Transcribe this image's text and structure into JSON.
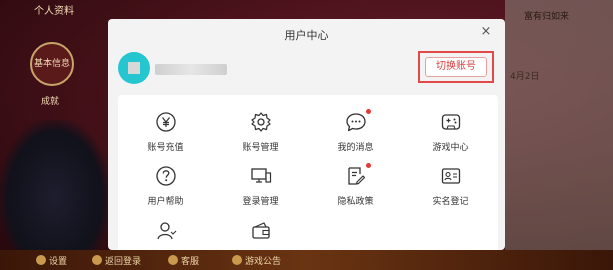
{
  "background": {
    "title": "个人资料",
    "badges": [
      "基本信息",
      "成就"
    ],
    "right_labels": [
      "富有归如来",
      "4月2日"
    ],
    "bottom_bar": [
      "设置",
      "返回登录",
      "客服",
      "游戏公告"
    ]
  },
  "modal": {
    "title": "用户中心",
    "close_label": "×",
    "switch_account_label": "切换账号",
    "grid": [
      {
        "label": "账号充值",
        "icon": "yen-icon",
        "dot": false
      },
      {
        "label": "账号管理",
        "icon": "gear-icon",
        "dot": false
      },
      {
        "label": "我的消息",
        "icon": "message-icon",
        "dot": true
      },
      {
        "label": "游戏中心",
        "icon": "gamepad-icon",
        "dot": false
      },
      {
        "label": "用户帮助",
        "icon": "help-icon",
        "dot": false
      },
      {
        "label": "登录管理",
        "icon": "devices-icon",
        "dot": false
      },
      {
        "label": "隐私政策",
        "icon": "privacy-document-icon",
        "dot": true
      },
      {
        "label": "实名登记",
        "icon": "id-card-icon",
        "dot": false
      },
      {
        "label": "",
        "icon": "user-icon",
        "dot": false
      },
      {
        "label": "",
        "icon": "wallet-icon",
        "dot": false
      }
    ],
    "colors": {
      "accent": "#d64040",
      "avatar": "#26c6d0",
      "dot": "#e53935"
    }
  }
}
